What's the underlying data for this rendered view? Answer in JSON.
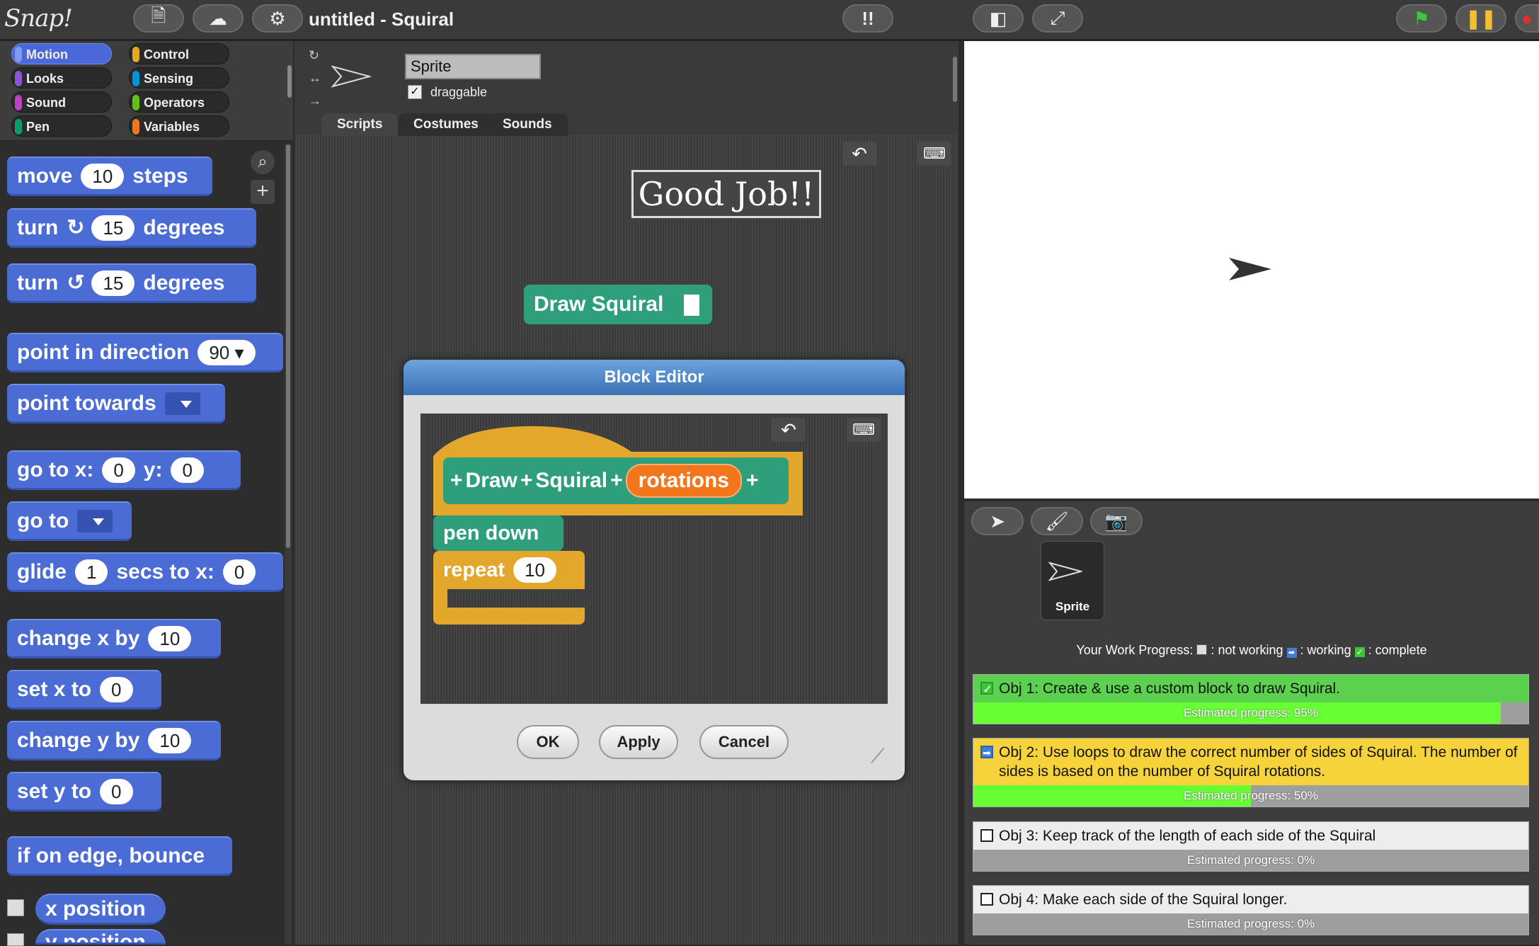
{
  "topbar": {
    "logo": "Snap!",
    "title": "untitled - Squiral"
  },
  "categories": [
    {
      "label": "Motion",
      "color": "#4a6cd4",
      "selected": true
    },
    {
      "label": "Looks",
      "color": "#8a55d7"
    },
    {
      "label": "Sound",
      "color": "#bb42c3"
    },
    {
      "label": "Pen",
      "color": "#0e9a6c"
    },
    {
      "label": "Control",
      "color": "#e6a822"
    },
    {
      "label": "Sensing",
      "color": "#0494dc"
    },
    {
      "label": "Operators",
      "color": "#62c213"
    },
    {
      "label": "Variables",
      "color": "#f3761d"
    }
  ],
  "palette": {
    "move": {
      "pre": "move",
      "val": "10",
      "post": "steps"
    },
    "turn_cw": {
      "pre": "turn",
      "val": "15",
      "post": "degrees"
    },
    "turn_ccw": {
      "pre": "turn",
      "val": "15",
      "post": "degrees"
    },
    "point_dir": {
      "pre": "point in direction",
      "val": "90"
    },
    "point_towards": {
      "pre": "point towards"
    },
    "goto_xy": {
      "pre": "go to x:",
      "x": "0",
      "mid": "y:",
      "y": "0"
    },
    "goto": {
      "pre": "go to"
    },
    "glide": {
      "pre": "glide",
      "val": "1",
      "mid": "secs to x:",
      "x": "0"
    },
    "change_x": {
      "pre": "change x by",
      "val": "10"
    },
    "set_x": {
      "pre": "set x to",
      "val": "0"
    },
    "change_y": {
      "pre": "change y by",
      "val": "10"
    },
    "set_y": {
      "pre": "set y to",
      "val": "0"
    },
    "bounce": {
      "pre": "if on edge, bounce"
    },
    "x_position": {
      "pre": "x position"
    },
    "y_position": {
      "pre": "y position"
    }
  },
  "sprite": {
    "name": "Sprite",
    "draggable_label": "draggable",
    "draggable": true
  },
  "tabs": [
    "Scripts",
    "Costumes",
    "Sounds"
  ],
  "script": {
    "good_job": "Good Job!!",
    "draw_block": "Draw Squiral"
  },
  "block_editor": {
    "title": "Block Editor",
    "hat_word1": "Draw",
    "hat_word2": "Squiral",
    "param": "rotations",
    "pen_down": "pen down",
    "repeat": "repeat",
    "repeat_val": "10",
    "ok": "OK",
    "apply": "Apply",
    "cancel": "Cancel"
  },
  "corral": {
    "sprite_label": "Sprite"
  },
  "progress": {
    "legend_prefix": "Your Work Progress:",
    "legend_not": ": not working",
    "legend_working": ": working",
    "legend_complete": ": complete",
    "objectives": [
      {
        "text": "Obj 1: Create & use a custom block to draw Squiral.",
        "status": "complete",
        "bar_label": "Estimated progress: 95%",
        "progress": 0.95,
        "bg": "#5cd150"
      },
      {
        "text": "Obj 2: Use loops to draw the correct number of sides of Squiral. The number of sides is based on the number of Squiral rotations.",
        "status": "working",
        "bar_label": "Estimated progress: 50%",
        "progress": 0.5,
        "bg": "#f6d33b"
      },
      {
        "text": "Obj 3: Keep track of the length of each side of the Squiral",
        "status": "not",
        "bar_label": "Estimated progress: 0%",
        "progress": 0,
        "bg": "#ededed"
      },
      {
        "text": "Obj 4: Make each side of the Squiral longer.",
        "status": "not",
        "bar_label": "Estimated progress: 0%",
        "progress": 0,
        "bg": "#ededed"
      }
    ]
  }
}
